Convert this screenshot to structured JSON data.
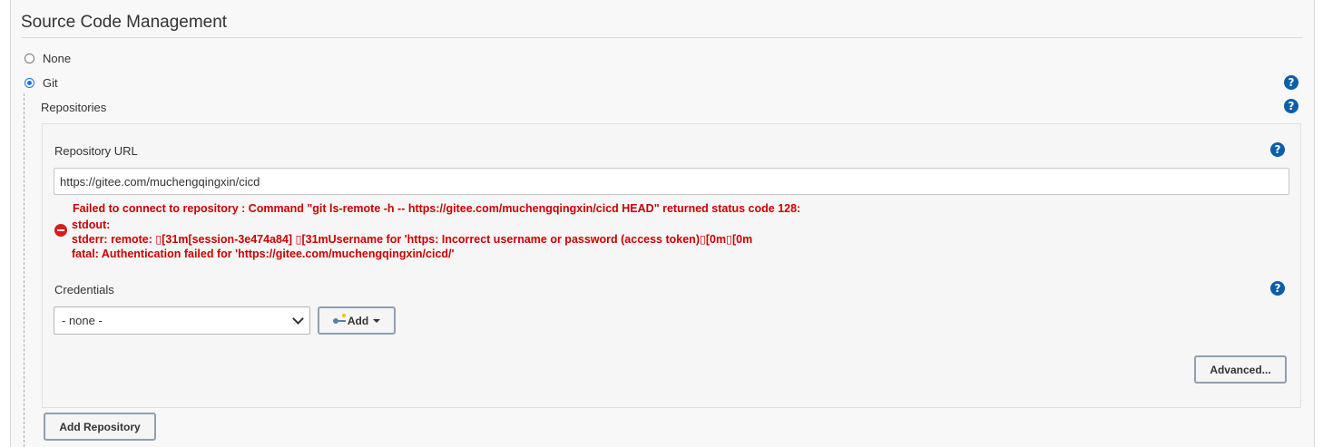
{
  "section": {
    "title": "Source Code Management"
  },
  "scm_options": [
    {
      "label": "None",
      "checked": false
    },
    {
      "label": "Git",
      "checked": true
    }
  ],
  "repositories": {
    "label": "Repositories",
    "url_label": "Repository URL",
    "url_value": "https://gitee.com/muchengqingxin/cicd",
    "error_lines": [
      "Failed to connect to repository : Command \"git ls-remote -h -- https://gitee.com/muchengqingxin/cicd HEAD\" returned status code 128:",
      "stdout:",
      "stderr: remote: ▯[31m[session-3e474a84] ▯[31mUsername for 'https: Incorrect username or password (access token)▯[0m▯[0m",
      "fatal: Authentication failed for 'https://gitee.com/muchengqingxin/cicd/'"
    ],
    "credentials_label": "Credentials",
    "credentials_selected": "- none -",
    "add_button": "Add",
    "advanced_button": "Advanced...",
    "add_repository_button": "Add Repository"
  },
  "help_icon": "?",
  "colors": {
    "error": "#cc0000",
    "help": "#0b5ea8",
    "radio_accent": "#1a73e8"
  },
  "icons": {
    "help": "help-icon",
    "error": "error-icon",
    "key": "key-icon",
    "dropdown": "chevron-down-icon"
  }
}
